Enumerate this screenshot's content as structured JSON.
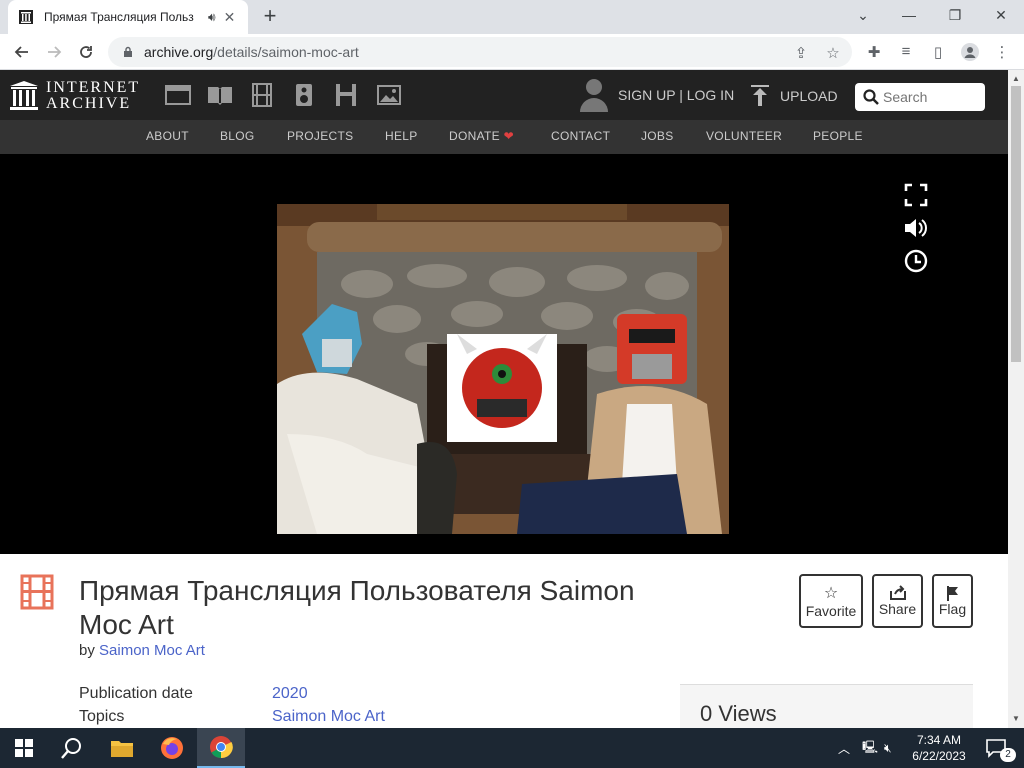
{
  "browser": {
    "tab_title": "Прямая Трансляция Польз",
    "url_host": "archive.org",
    "url_path": "/details/saimon-moc-art"
  },
  "ia": {
    "logo_line1": "INTERNET",
    "logo_line2": "ARCHIVE",
    "auth": "SIGN UP | LOG IN",
    "upload": "UPLOAD",
    "search_placeholder": "Search",
    "nav": [
      "ABOUT",
      "BLOG",
      "PROJECTS",
      "HELP",
      "DONATE",
      "CONTACT",
      "JOBS",
      "VOLUNTEER",
      "PEOPLE"
    ],
    "colors": {
      "donate_heart": "#e04040",
      "link": "#4b64c9",
      "film_icon": "#e8735a"
    }
  },
  "item": {
    "title": "Прямая Трансляция Пользователя Saimon Moc Art",
    "by_label": "by",
    "author": "Saimon Moc Art",
    "actions": [
      "Favorite",
      "Share",
      "Flag"
    ],
    "meta": [
      {
        "label": "Publication date",
        "value": "2020"
      },
      {
        "label": "Topics",
        "value": "Saimon Moc Art"
      }
    ],
    "views": "0 Views"
  },
  "taskbar": {
    "time": "7:34 AM",
    "date": "6/22/2023",
    "notifications": "2"
  }
}
